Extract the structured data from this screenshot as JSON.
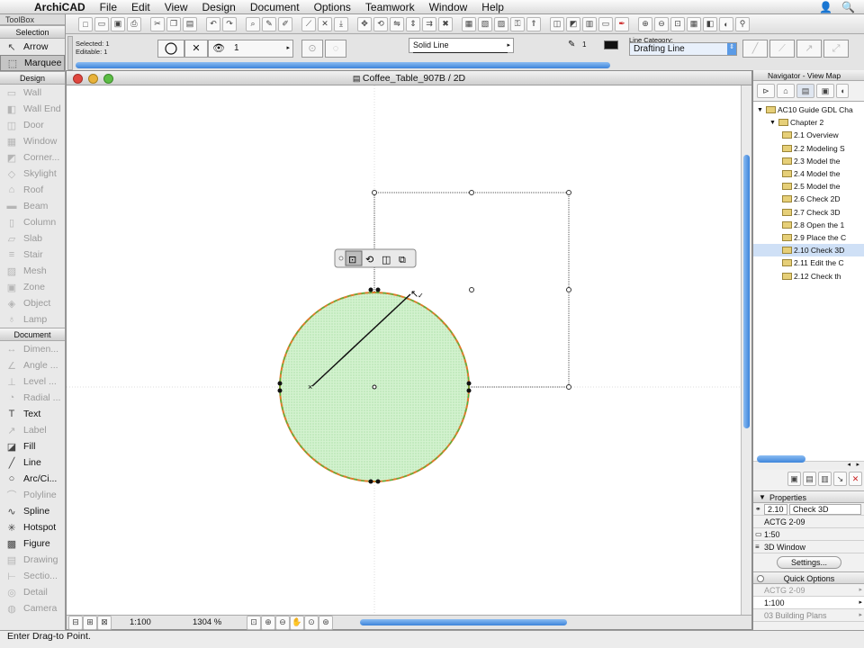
{
  "menubar": {
    "app_name": "ArchiCAD",
    "items": [
      "File",
      "Edit",
      "View",
      "Design",
      "Document",
      "Options",
      "Teamwork",
      "Window",
      "Help"
    ]
  },
  "toolbox": {
    "title": "ToolBox",
    "selection_header": "Selection",
    "selection_tools": [
      {
        "label": "Arrow",
        "icon": "arrow-icon",
        "glyph": "↖",
        "dim": false,
        "selected": false
      },
      {
        "label": "Marquee",
        "icon": "marquee-icon",
        "glyph": "⬚",
        "dim": false,
        "selected": true
      }
    ],
    "design_header": "Design",
    "design_tools": [
      {
        "label": "Wall",
        "icon": "wall-icon",
        "glyph": "▭",
        "dim": true
      },
      {
        "label": "Wall End",
        "icon": "wall-end-icon",
        "glyph": "◧",
        "dim": true
      },
      {
        "label": "Door",
        "icon": "door-icon",
        "glyph": "◫",
        "dim": true
      },
      {
        "label": "Window",
        "icon": "window-icon",
        "glyph": "▦",
        "dim": true
      },
      {
        "label": "Corner...",
        "icon": "corner-window-icon",
        "glyph": "◩",
        "dim": true
      },
      {
        "label": "Skylight",
        "icon": "skylight-icon",
        "glyph": "◇",
        "dim": true
      },
      {
        "label": "Roof",
        "icon": "roof-icon",
        "glyph": "⌂",
        "dim": true
      },
      {
        "label": "Beam",
        "icon": "beam-icon",
        "glyph": "▬",
        "dim": true
      },
      {
        "label": "Column",
        "icon": "column-icon",
        "glyph": "▯",
        "dim": true
      },
      {
        "label": "Slab",
        "icon": "slab-icon",
        "glyph": "▱",
        "dim": true
      },
      {
        "label": "Stair",
        "icon": "stair-icon",
        "glyph": "≡",
        "dim": true
      },
      {
        "label": "Mesh",
        "icon": "mesh-icon",
        "glyph": "▨",
        "dim": true
      },
      {
        "label": "Zone",
        "icon": "zone-icon",
        "glyph": "▣",
        "dim": true
      },
      {
        "label": "Object",
        "icon": "object-icon",
        "glyph": "◈",
        "dim": true
      },
      {
        "label": "Lamp",
        "icon": "lamp-icon",
        "glyph": "♁",
        "dim": true
      }
    ],
    "document_header": "Document",
    "document_tools": [
      {
        "label": "Dimen...",
        "icon": "dimension-icon",
        "glyph": "↔",
        "dim": true
      },
      {
        "label": "Angle ...",
        "icon": "angle-dimension-icon",
        "glyph": "∠",
        "dim": true
      },
      {
        "label": "Level ...",
        "icon": "level-dimension-icon",
        "glyph": "⊥",
        "dim": true
      },
      {
        "label": "Radial ...",
        "icon": "radial-dimension-icon",
        "glyph": "◔",
        "dim": true
      },
      {
        "label": "Text",
        "icon": "text-icon",
        "glyph": "T",
        "dim": false
      },
      {
        "label": "Label",
        "icon": "label-icon",
        "glyph": "↗",
        "dim": true
      },
      {
        "label": "Fill",
        "icon": "fill-icon",
        "glyph": "◪",
        "dim": false
      },
      {
        "label": "Line",
        "icon": "line-icon",
        "glyph": "╱",
        "dim": false
      },
      {
        "label": "Arc/Ci...",
        "icon": "arc-circle-icon",
        "glyph": "○",
        "dim": false
      },
      {
        "label": "Polyline",
        "icon": "polyline-icon",
        "glyph": "⌒",
        "dim": true
      },
      {
        "label": "Spline",
        "icon": "spline-icon",
        "glyph": "∿",
        "dim": false
      },
      {
        "label": "Hotspot",
        "icon": "hotspot-icon",
        "glyph": "✳",
        "dim": false
      },
      {
        "label": "Figure",
        "icon": "figure-icon",
        "glyph": "▩",
        "dim": false
      },
      {
        "label": "Drawing",
        "icon": "drawing-icon",
        "glyph": "▤",
        "dim": true
      },
      {
        "label": "Sectio...",
        "icon": "section-icon",
        "glyph": "⊢",
        "dim": true
      },
      {
        "label": "Detail",
        "icon": "detail-icon",
        "glyph": "◎",
        "dim": true
      },
      {
        "label": "Camera",
        "icon": "camera-icon",
        "glyph": "◍",
        "dim": true
      }
    ]
  },
  "infobox": {
    "selected_label": "Selected: 1",
    "editable_label": "Editable: 1",
    "layer_value": "1",
    "line_type": "Solid Line",
    "pen_number": "1",
    "line_category_label": "Line Category:",
    "line_category_value": "Drafting Line"
  },
  "document": {
    "title": "Coffee_Table_907B / 2D",
    "scale": "1:100",
    "zoom": "1304 %"
  },
  "navigator": {
    "title": "Navigator - View Map",
    "tree": [
      {
        "label": "AC10 Guide GDL Cha",
        "indent": 0,
        "highlight": false
      },
      {
        "label": "Chapter 2",
        "indent": 1,
        "highlight": false
      },
      {
        "label": "2.1 Overview",
        "indent": 2,
        "highlight": false
      },
      {
        "label": "2.2 Modeling S",
        "indent": 2,
        "highlight": false
      },
      {
        "label": "2.3 Model the",
        "indent": 2,
        "highlight": false
      },
      {
        "label": "2.4 Model the",
        "indent": 2,
        "highlight": false
      },
      {
        "label": "2.5 Model the",
        "indent": 2,
        "highlight": false
      },
      {
        "label": "2.6 Check 2D",
        "indent": 2,
        "highlight": false
      },
      {
        "label": "2.7 Check 3D",
        "indent": 2,
        "highlight": false
      },
      {
        "label": "2.8 Open the 1",
        "indent": 2,
        "highlight": false
      },
      {
        "label": "2.9 Place the C",
        "indent": 2,
        "highlight": false
      },
      {
        "label": "2.10 Check 3D",
        "indent": 2,
        "highlight": true
      },
      {
        "label": "2.11 Edit the C",
        "indent": 2,
        "highlight": false
      },
      {
        "label": "2.12 Check th",
        "indent": 2,
        "highlight": false
      }
    ],
    "properties_header": "Properties",
    "prop_id": "2.10",
    "prop_name": "Check 3D",
    "prop_layer_combo": "ACTG 2-09",
    "prop_scale": "1:50",
    "prop_window": "3D Window",
    "settings_button": "Settings...",
    "quick_options_header": "Quick Options",
    "quick_layer_combo": "ACTG 2-09",
    "quick_scale": "1:100",
    "quick_model_view": "03 Building Plans"
  },
  "status": {
    "message": "Enter Drag-to Point."
  },
  "colors": {
    "circle_fill": "#c9efc6",
    "circle_outline": "#e07a2c",
    "circle_dash": "#3fbf3f",
    "scrollbar_blue": "#5b9be6"
  }
}
